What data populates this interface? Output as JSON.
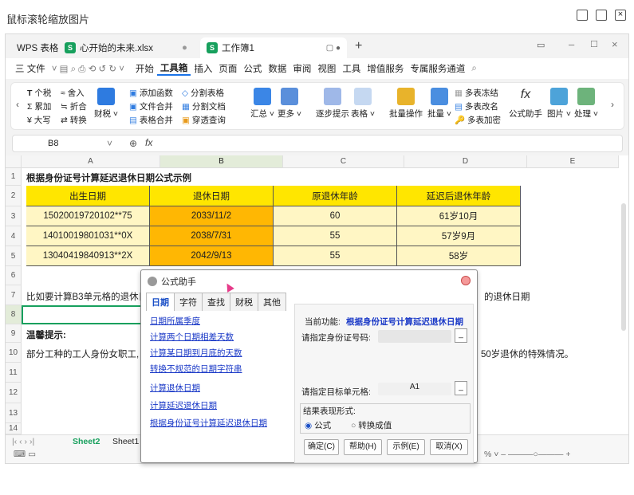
{
  "viewer": {
    "title": "鼠标滚轮缩放图片"
  },
  "tabs": [
    {
      "label": "WPS 表格"
    },
    {
      "label": "心开始的未来.xlsx"
    },
    {
      "label": "工作簿1"
    }
  ],
  "menu": {
    "file": "三 文件",
    "items": [
      "开始",
      "工具箱",
      "插入",
      "页面",
      "公式",
      "数据",
      "审阅",
      "视图",
      "工具",
      "增值服务",
      "专属服务通道"
    ]
  },
  "ribbon": {
    "col1": [
      "个税",
      "累加",
      "大写"
    ],
    "col2": [
      "舍入",
      "折合",
      "转换"
    ],
    "fin": "财税",
    "col3": [
      "添加函数",
      "文件合并",
      "表格合并"
    ],
    "col4": [
      "分割表格",
      "分割文档",
      "穿透查询"
    ],
    "big1": [
      "汇总",
      "更多",
      "逐步提示",
      "表格"
    ],
    "big2": [
      "批量操作",
      "批量"
    ],
    "col5": [
      "多表冻结",
      "多表改名",
      "多表加密"
    ],
    "big3": [
      "公式助手",
      "图片",
      "处理"
    ]
  },
  "formula": {
    "cell_ref": "B8",
    "fx": "fx"
  },
  "sheet": {
    "columns": [
      "A",
      "B",
      "C",
      "D",
      "E"
    ],
    "rows": [
      "1",
      "2",
      "3",
      "4",
      "5",
      "6",
      "7",
      "8",
      "9",
      "10",
      "11",
      "12",
      "13",
      "14"
    ],
    "title": "根据身份证号计算延迟退休日期公式示例",
    "headers": [
      "出生日期",
      "退休日期",
      "原退休年龄",
      "延迟后退休年龄"
    ],
    "data": [
      [
        "15020019720102**75",
        "2033/11/2",
        "60",
        "61岁10月"
      ],
      [
        "14010019801031**0X",
        "2038/7/31",
        "55",
        "57岁9月"
      ],
      [
        "13040419840913**2X",
        "2042/9/13",
        "55",
        "58岁"
      ]
    ],
    "row7_left": "比如要计算B3单元格的退休日",
    "row7_right": "的退休日期",
    "row9": "温馨提示:",
    "row10_left": "部分工种的工人身份女职工,",
    "row10_right": "50岁退休的特殊情况。"
  },
  "sheet_tabs": [
    "Sheet2",
    "Sheet1"
  ],
  "dialog": {
    "title": "公式助手",
    "tabs": [
      "日期",
      "字符",
      "查找",
      "财税",
      "其他"
    ],
    "links": [
      "日期所属季度",
      "计算两个日期相差天数",
      "计算某日期到月底的天数",
      "转换不规范的日期字符串",
      "计算退休日期",
      "计算延迟退休日期",
      "根据身份证号计算延迟退休日期"
    ],
    "current_label": "当前功能:",
    "current_value": "根据身份证号计算延迟退休日期",
    "id_label": "请指定身份证号码:",
    "target_label": "请指定目标单元格:",
    "target_value": "A1",
    "result_label": "结果表现形式:",
    "radio_formula": "公式",
    "radio_value": "转换成值",
    "buttons": [
      "确定(C)",
      "帮助(H)",
      "示例(E)",
      "取消(X)"
    ]
  },
  "colors": {
    "header_yellow": "#FFE600",
    "date_orange": "#FFB703",
    "light_yellow": "#FFF6C4",
    "accent_green": "#17A05D"
  }
}
